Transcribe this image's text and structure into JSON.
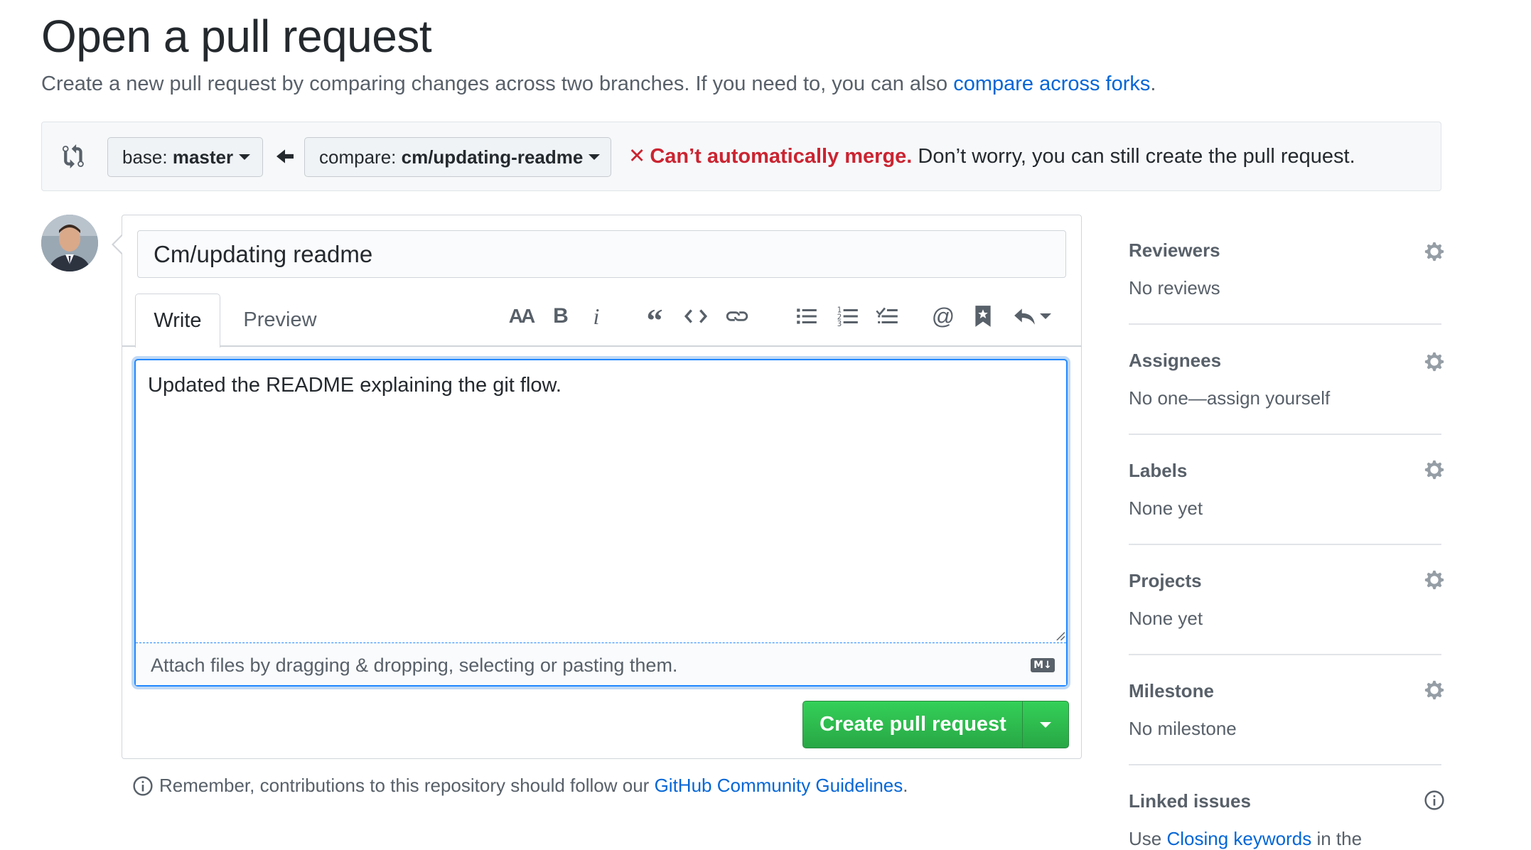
{
  "page": {
    "title": "Open a pull request",
    "subtitle_prefix": "Create a new pull request by comparing changes across two branches. If you need to, you can also ",
    "subtitle_link": "compare across forks",
    "subtitle_suffix": "."
  },
  "range": {
    "base_label": "base:",
    "base_branch": "master",
    "compare_label": "compare:",
    "compare_branch": "cm/updating-readme",
    "merge_icon": "✕",
    "merge_status": "Can’t automatically merge.",
    "merge_note": " Don’t worry, you can still create the pull request."
  },
  "composer": {
    "title_value": "Cm/updating readme",
    "tabs": {
      "write": "Write",
      "preview": "Preview"
    },
    "toolbar_icons": [
      "text-size-icon",
      "bold-icon",
      "italic-icon",
      "quote-icon",
      "code-icon",
      "link-icon",
      "bulleted-list-icon",
      "numbered-list-icon",
      "task-list-icon",
      "mention-icon",
      "saved-reply-icon",
      "reply-icon"
    ],
    "body_text": "Updated the README explaining the git flow.",
    "attach_hint": "Attach files by dragging & dropping, selecting or pasting them.",
    "markdown_badge": "M↓",
    "submit_label": "Create pull request"
  },
  "guidelines": {
    "prefix": "Remember, contributions to this repository should follow our ",
    "link": "GitHub Community Guidelines",
    "suffix": "."
  },
  "sidebar": {
    "reviewers": {
      "title": "Reviewers",
      "value": "No reviews"
    },
    "assignees": {
      "title": "Assignees",
      "value": "No one—assign yourself"
    },
    "labels": {
      "title": "Labels",
      "value": "None yet"
    },
    "projects": {
      "title": "Projects",
      "value": "None yet"
    },
    "milestone": {
      "title": "Milestone",
      "value": "No milestone"
    },
    "linked_issues": {
      "title": "Linked issues",
      "value_prefix": "Use ",
      "value_link": "Closing keywords",
      "value_suffix": " in the"
    }
  },
  "colors": {
    "error": "#cb2431",
    "link": "#0366d6",
    "primary_button": "#2ea44f",
    "focus_border": "#2188ff"
  }
}
